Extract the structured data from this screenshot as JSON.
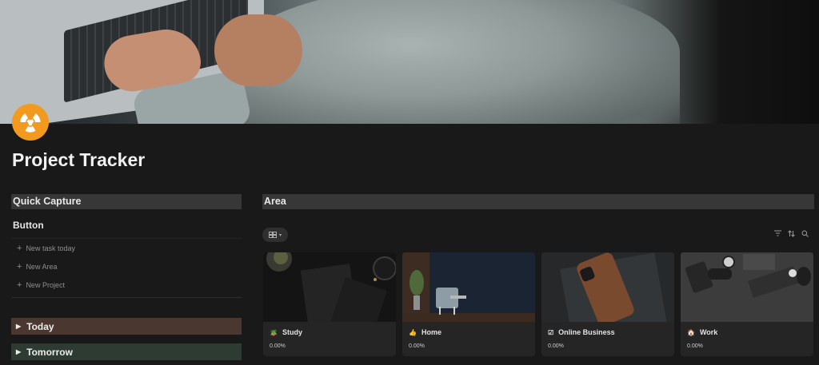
{
  "page": {
    "title": "Project Tracker",
    "icon": "radiation-icon",
    "accent": "#f29a1e"
  },
  "quick_capture": {
    "heading": "Quick Capture",
    "button_title": "Button",
    "buttons": [
      {
        "label": "New task today"
      },
      {
        "label": "New Area"
      },
      {
        "label": "New Project"
      }
    ]
  },
  "toggles": [
    {
      "label": "Today",
      "color": "#4a3730"
    },
    {
      "label": "Tomorrow",
      "color": "#2d3b33"
    }
  ],
  "area": {
    "heading": "Area",
    "view_icon": "gallery-view-icon",
    "toolbar_icons": [
      "filter-icon",
      "sort-icon",
      "search-icon"
    ],
    "cards": [
      {
        "name": "Study",
        "emoji": "🪴",
        "progress": "0.00%"
      },
      {
        "name": "Home",
        "emoji": "👍",
        "progress": "0.00%"
      },
      {
        "name": "Online Business",
        "emoji": "☑",
        "progress": "0.00%"
      },
      {
        "name": "Work",
        "emoji": "🏠",
        "progress": "0.00%"
      }
    ]
  }
}
